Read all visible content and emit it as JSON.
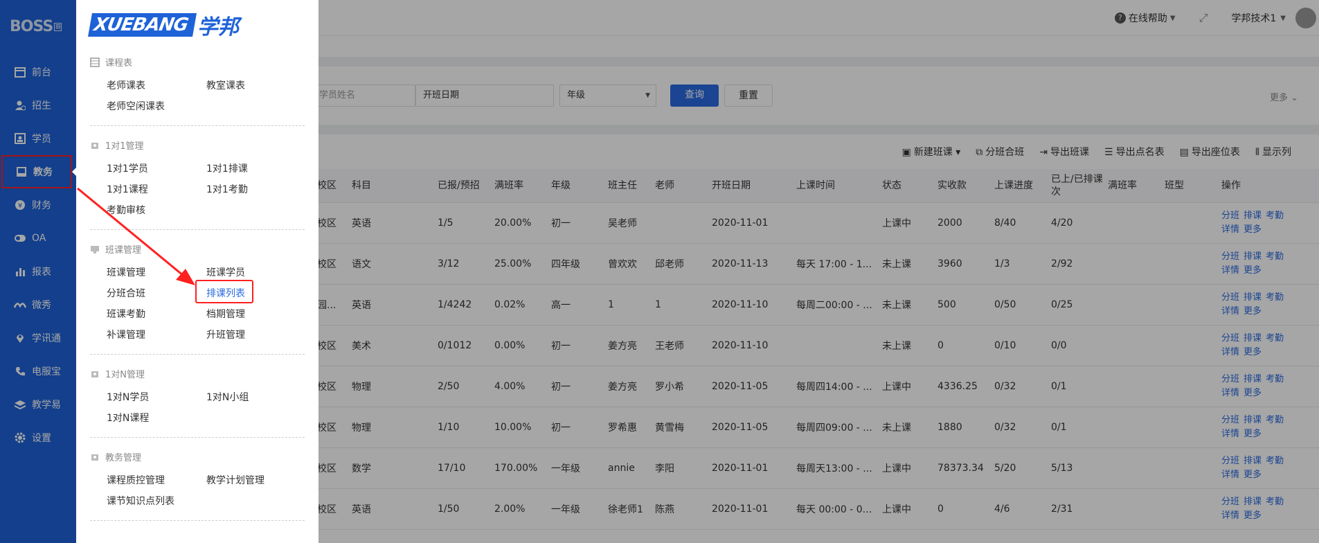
{
  "sidebar": {
    "logo": "BOSS",
    "logo_sub": "⊞",
    "items": [
      {
        "label": "前台",
        "icon": "calendar-icon"
      },
      {
        "label": "招生",
        "icon": "user-plus-icon"
      },
      {
        "label": "学员",
        "icon": "id-card-icon"
      },
      {
        "label": "教务",
        "icon": "book-icon"
      },
      {
        "label": "财务",
        "icon": "yen-icon"
      },
      {
        "label": "OA",
        "icon": "toggle-icon"
      },
      {
        "label": "报表",
        "icon": "bar-chart-icon"
      },
      {
        "label": "微秀",
        "icon": "wave-icon"
      },
      {
        "label": "学讯通",
        "icon": "location-icon"
      },
      {
        "label": "电服宝",
        "icon": "phone-icon"
      },
      {
        "label": "教学易",
        "icon": "layers-icon"
      },
      {
        "label": "设置",
        "icon": "gear-icon"
      }
    ]
  },
  "topbar": {
    "help": "在线帮助",
    "user": "学邦技术1"
  },
  "filters": {
    "student_placeholder": "学员姓名",
    "date_placeholder": "开班日期",
    "grade_placeholder": "年级",
    "query": "查询",
    "reset": "重置",
    "more": "更多"
  },
  "toolbar": {
    "new_class": "新建班课",
    "split_merge": "分班合班",
    "export_class": "导出班课",
    "export_roll": "导出点名表",
    "export_seat": "导出座位表",
    "show_cols": "显示列"
  },
  "table": {
    "headers": [
      "校区",
      "科目",
      "已报/预招",
      "满班率",
      "年级",
      "班主任",
      "老师",
      "开班日期",
      "上课时间",
      "状态",
      "实收款",
      "上课进度",
      "已上/已排课次",
      "满班率",
      "班型",
      "操作"
    ],
    "rows": [
      [
        "校区",
        "英语",
        "1/5",
        "20.00%",
        "初一",
        "吴老师",
        "",
        "2020-11-01",
        "",
        "上课中",
        "2000",
        "8/40",
        "4/20"
      ],
      [
        "校区",
        "语文",
        "3/12",
        "25.00%",
        "四年级",
        "曾欢欢",
        "邱老师",
        "2020-11-13",
        "每天 17:00 - 1...",
        "未上课",
        "3960",
        "1/3",
        "2/92"
      ],
      [
        "园...",
        "英语",
        "1/4242",
        "0.02%",
        "高一",
        "1",
        "1",
        "2020-11-10",
        "每周二00:00 - ...",
        "未上课",
        "500",
        "0/50",
        "0/25"
      ],
      [
        "校区",
        "美术",
        "0/1012",
        "0.00%",
        "初一",
        "姜方亮",
        "王老师",
        "2020-11-10",
        "",
        "未上课",
        "0",
        "0/10",
        "0/0"
      ],
      [
        "校区",
        "物理",
        "2/50",
        "4.00%",
        "初一",
        "姜方亮",
        "罗小希",
        "2020-11-05",
        "每周四14:00 - ...",
        "上课中",
        "4336.25",
        "0/32",
        "0/1"
      ],
      [
        "校区",
        "物理",
        "1/10",
        "10.00%",
        "初一",
        "罗希惠",
        "黄雪梅",
        "2020-11-05",
        "每周四09:00 - ...",
        "未上课",
        "1880",
        "0/32",
        "0/1"
      ],
      [
        "校区",
        "数学",
        "17/10",
        "170.00%",
        "一年级",
        "annie",
        "李阳",
        "2020-11-01",
        "每周天13:00 - ...",
        "上课中",
        "78373.34",
        "5/20",
        "5/13"
      ],
      [
        "校区",
        "英语",
        "1/50",
        "2.00%",
        "一年级",
        "徐老师1",
        "陈燕",
        "2020-11-01",
        "每天 00:00 - 0...",
        "上课中",
        "0",
        "4/6",
        "2/31"
      ]
    ],
    "ops": [
      "分班",
      "排课",
      "考勤",
      "详情",
      "更多"
    ]
  },
  "flyout": {
    "brand_en": "XUEBANG",
    "brand_cn": "学邦",
    "groups": [
      {
        "title": "课程表",
        "icon": "table-icon",
        "links": [
          "老师课表",
          "教室课表",
          "老师空闲课表"
        ]
      },
      {
        "title": "1对1管理",
        "icon": "one-on-one-icon",
        "links": [
          "1对1学员",
          "1对1排课",
          "1对1课程",
          "1对1考勤",
          "考勤审核"
        ]
      },
      {
        "title": "班课管理",
        "icon": "class-icon",
        "links": [
          "班课管理",
          "班课学员",
          "分班合班",
          "排课列表",
          "班课考勤",
          "档期管理",
          "补课管理",
          "升班管理"
        ]
      },
      {
        "title": "1对N管理",
        "icon": "one-to-n-icon",
        "links": [
          "1对N学员",
          "1对N小组",
          "1对N课程"
        ]
      },
      {
        "title": "教务管理",
        "icon": "admin-icon",
        "links": [
          "课程质控管理",
          "教学计划管理",
          "课节知识点列表"
        ]
      }
    ]
  },
  "colors": {
    "primary": "#1e62d8",
    "highlight": "#ff2020",
    "link": "#2a6ae0"
  }
}
